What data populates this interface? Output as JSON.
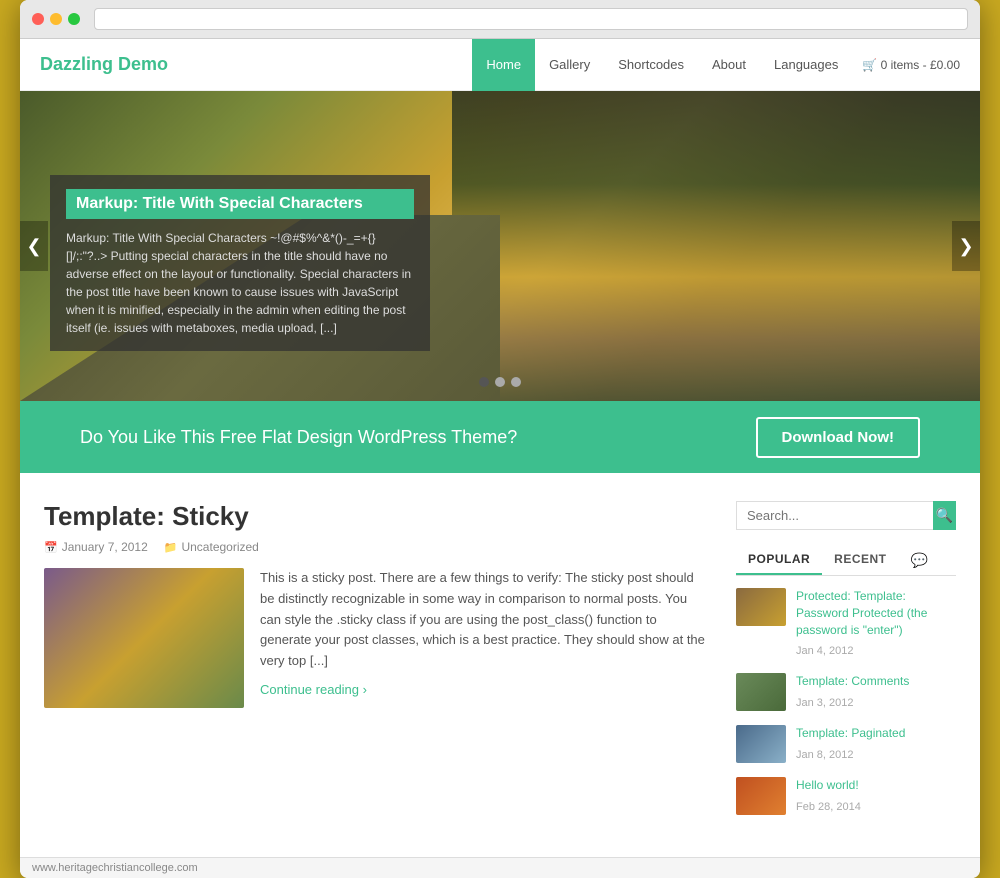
{
  "browser": {
    "statusbar_url": "www.heritagechristiancollege.com"
  },
  "nav": {
    "logo": "Dazzling Demo",
    "items": [
      {
        "label": "Home",
        "active": true
      },
      {
        "label": "Gallery",
        "active": false
      },
      {
        "label": "Shortcodes",
        "active": false
      },
      {
        "label": "About",
        "active": false
      },
      {
        "label": "Languages",
        "active": false
      }
    ],
    "cart": "0 items - £0.00"
  },
  "hero": {
    "caption_title": "Markup: Title With Special Characters",
    "caption_text": "Markup: Title With Special Characters ~!@#$%^&*()-_=+{}[]/;:\"?..> Putting special characters in the title should have no adverse effect on the layout or functionality. Special characters in the post title have been known to cause issues with JavaScript when it is minified, especially in the admin when editing the post itself (ie. issues with metaboxes, media upload, [...]",
    "dots": [
      {
        "active": true
      },
      {
        "active": false
      },
      {
        "active": false
      }
    ],
    "arrow_left": "❮",
    "arrow_right": "❯"
  },
  "cta": {
    "text": "Do You Like This Free Flat Design WordPress Theme?",
    "button_label": "Download Now!"
  },
  "post": {
    "title": "Template: Sticky",
    "date": "January 7, 2012",
    "category": "Uncategorized",
    "excerpt": "This is a sticky post. There are a few things to verify: The sticky post should be distinctly recognizable in some way in comparison to normal posts. You can style the .sticky class if you are using the post_class() function to generate your post classes, which is a best practice. They should show at the very top [...]",
    "read_more": "Continue reading"
  },
  "sidebar": {
    "search_placeholder": "Search...",
    "search_icon": "🔍",
    "tabs": [
      {
        "label": "POPULAR",
        "active": true
      },
      {
        "label": "RECENT",
        "active": false
      },
      {
        "label": "💬",
        "active": false
      }
    ],
    "posts": [
      {
        "title": "Protected: Template: Password Protected (the password is \"enter\")",
        "date": "Jan 4, 2012",
        "thumb_class": "thumb-1"
      },
      {
        "title": "Template: Comments",
        "date": "Jan 3, 2012",
        "thumb_class": "thumb-2"
      },
      {
        "title": "Template: Paginated",
        "date": "Jan 8, 2012",
        "thumb_class": "thumb-3"
      },
      {
        "title": "Hello world!",
        "date": "Feb 28, 2014",
        "thumb_class": "thumb-4"
      }
    ]
  }
}
